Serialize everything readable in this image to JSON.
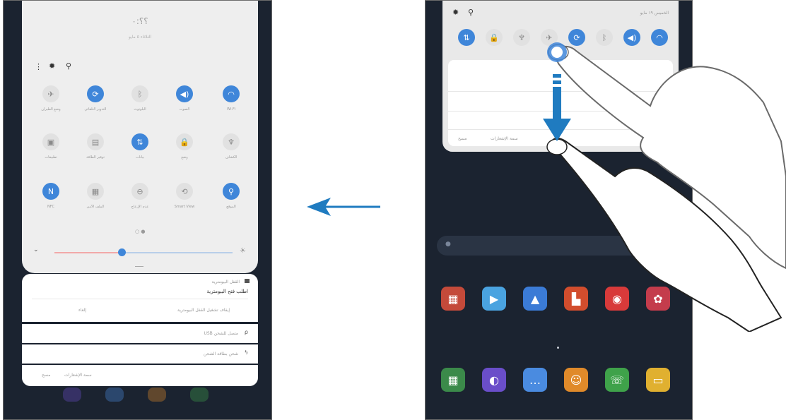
{
  "arrow_color": "#1f7bc0",
  "accent": "#3f86d9",
  "left": {
    "header": {
      "time": "؟؟:٠",
      "date": "الثلاثاء ٥ مايو"
    },
    "qs_row1": [
      {
        "icon": "airplane-icon",
        "glyph": "✈",
        "on": false,
        "label": "وضع الطيران"
      },
      {
        "icon": "autorotate-icon",
        "glyph": "⟳",
        "on": true,
        "label": "التدوير التلقائي"
      },
      {
        "icon": "bluetooth-icon",
        "glyph": "ᛒ",
        "on": false,
        "label": "البلوتوث"
      },
      {
        "icon": "sound-icon",
        "glyph": "◀)",
        "on": true,
        "label": "الصوت"
      },
      {
        "icon": "wifi-icon",
        "glyph": "◠",
        "on": true,
        "label": "Wi-Fi"
      }
    ],
    "qs_row2": [
      {
        "icon": "screen-share-icon",
        "glyph": "▣",
        "on": false,
        "label": "تطبيقات"
      },
      {
        "icon": "power-saving-icon",
        "glyph": "▤",
        "on": false,
        "label": "توفير الطاقة"
      },
      {
        "icon": "mobile-data-icon",
        "glyph": "⇅",
        "on": true,
        "label": "بيانات"
      },
      {
        "icon": "lock-icon",
        "glyph": "🔒",
        "on": false,
        "label": "وضع"
      },
      {
        "icon": "flashlight-icon",
        "glyph": "♆",
        "on": false,
        "label": "الكشاف"
      }
    ],
    "qs_row3": [
      {
        "icon": "nfc-icon",
        "glyph": "N",
        "on": true,
        "label": "NFC"
      },
      {
        "icon": "folder-icon",
        "glyph": "▦",
        "on": false,
        "label": "الملف الآمن"
      },
      {
        "icon": "do-not-disturb-icon",
        "glyph": "⊖",
        "on": false,
        "label": "عدم الإزعاج"
      },
      {
        "icon": "smart-view-icon",
        "glyph": "⟲",
        "on": false,
        "label": "Smart View"
      },
      {
        "icon": "location-icon",
        "glyph": "⚲",
        "on": true,
        "label": "الموقع"
      }
    ],
    "notif1": {
      "title": "القفل البيومترية",
      "body": "اطلب فتح البيومترية",
      "action_left": "إلغاء",
      "action_right": "إيقاف تشغيل القفل البيومترية"
    },
    "notif2": "USB متصل للشحن",
    "notif3": "شحن بطاقة الشحن",
    "footer": {
      "left": "مسح",
      "right": "سمة الإشعارات"
    }
  },
  "right": {
    "status": "الخميس ١٩ مايو",
    "qs_row": [
      {
        "icon": "mobile-data-icon",
        "glyph": "⇅",
        "on": true
      },
      {
        "icon": "lock-icon",
        "glyph": "🔒",
        "on": false
      },
      {
        "icon": "flashlight-icon",
        "glyph": "♆",
        "on": false
      },
      {
        "icon": "airplane-icon",
        "glyph": "✈",
        "on": false
      },
      {
        "icon": "autorotate-icon",
        "glyph": "⟳",
        "on": true
      },
      {
        "icon": "bluetooth-icon",
        "glyph": "ᛒ",
        "on": false
      },
      {
        "icon": "sound-icon",
        "glyph": "◀)",
        "on": true
      },
      {
        "icon": "wifi-icon",
        "glyph": "◠",
        "on": true
      }
    ],
    "notif_footer": {
      "left": "مسح",
      "right": "سمة الإشعارات"
    },
    "apps_row1": [
      {
        "name": "folder-app-icon",
        "color": "#c44a3a",
        "glyph": "▦"
      },
      {
        "name": "play-store-icon",
        "color": "#4aa3e0",
        "glyph": "▶"
      },
      {
        "name": "drive-icon",
        "color": "#3b7bd6",
        "glyph": "▲"
      },
      {
        "name": "office-app-icon",
        "color": "#d24d2d",
        "glyph": "▙"
      },
      {
        "name": "camera-icon",
        "color": "#d83a3a",
        "glyph": "◉"
      },
      {
        "name": "gallery-icon",
        "color": "#c43c4c",
        "glyph": "✿"
      }
    ],
    "apps_row2": [
      {
        "name": "calendar-icon",
        "color": "#3b8a4a",
        "glyph": "▦"
      },
      {
        "name": "internet-icon",
        "color": "#6a4ec9",
        "glyph": "◐"
      },
      {
        "name": "messages-icon",
        "color": "#4a8be0",
        "glyph": "…"
      },
      {
        "name": "contacts-icon",
        "color": "#e08a2a",
        "glyph": "☺"
      },
      {
        "name": "phone-icon",
        "color": "#3fa24a",
        "glyph": "☏"
      },
      {
        "name": "email-icon",
        "color": "#e0b030",
        "glyph": "▭"
      }
    ]
  }
}
